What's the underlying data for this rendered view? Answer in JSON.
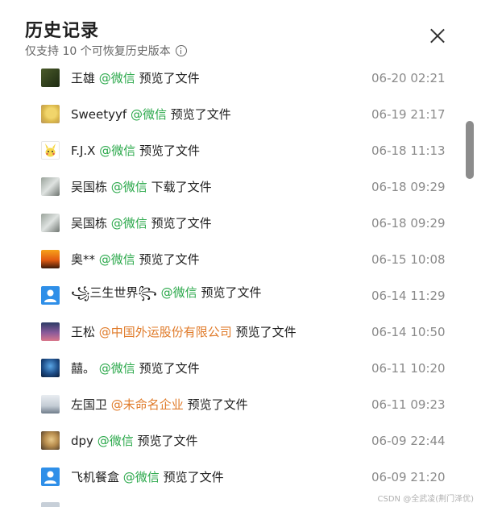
{
  "header": {
    "title": "历史记录",
    "subtitle": "仅支持 10 个可恢复历史版本"
  },
  "icons": {
    "info": "info-icon",
    "close": "close-icon"
  },
  "colors": {
    "wechat": "#2aa84a",
    "company": "#e07b2a"
  },
  "records": [
    {
      "name": "王雄",
      "source": "@微信",
      "action": "预览了文件",
      "time": "06-20 02:21"
    },
    {
      "name": "Sweetyyf",
      "source": "@微信",
      "action": "预览了文件",
      "time": "06-19 21:17"
    },
    {
      "name": "F.J.X",
      "source": "@微信",
      "action": "预览了文件",
      "time": "06-18 11:13"
    },
    {
      "name": "吴国栋",
      "source": "@微信",
      "action": "下载了文件",
      "time": "06-18 09:29"
    },
    {
      "name": "吴国栋",
      "source": "@微信",
      "action": "预览了文件",
      "time": "06-18 09:29"
    },
    {
      "name": "奥**",
      "source": "@微信",
      "action": "预览了文件",
      "time": "06-15 10:08"
    },
    {
      "name": "꧁三生世界꧂",
      "source": "@微信",
      "action": "预览了文件",
      "time": "06-14 11:29"
    },
    {
      "name": "王松",
      "source": "@中国外运股份有限公司",
      "action": "预览了文件",
      "time": "06-14 10:50"
    },
    {
      "name": "囍。",
      "source": "@微信",
      "action": "预览了文件",
      "time": "06-11 10:20"
    },
    {
      "name": "左国卫",
      "source": "@未命名企业",
      "action": "预览了文件",
      "time": "06-11 09:23"
    },
    {
      "name": "dpy",
      "source": "@微信",
      "action": "预览了文件",
      "time": "06-09 22:44"
    },
    {
      "name": "飞机餐盒",
      "source": "@微信",
      "action": "预览了文件",
      "time": "06-09 21:20"
    }
  ],
  "watermark": "CSDN @全武凌(荆门泽优)"
}
